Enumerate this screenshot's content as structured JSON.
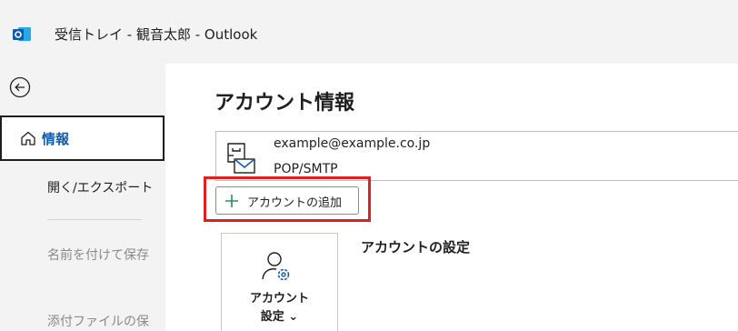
{
  "window": {
    "title": "受信トレイ - 観音太郎  -  Outlook"
  },
  "sidebar": {
    "back_icon": "back-arrow-icon",
    "items": [
      {
        "label": "情報",
        "icon": "home-icon",
        "selected": true
      },
      {
        "label": "開く/エクスポート"
      },
      {
        "label": "名前を付けて保存",
        "disabled": true
      },
      {
        "label": "添付ファイルの保",
        "disabled": true
      }
    ]
  },
  "main": {
    "title": "アカウント情報",
    "account": {
      "email": "example@example.co.jp",
      "type": "POP/SMTP"
    },
    "add_account_label": "アカウントの追加",
    "settings_button": {
      "line1": "アカウント",
      "line2": "設定 ⌄"
    },
    "settings_heading": "アカウントの設定"
  },
  "colors": {
    "accent": "#0f5cad",
    "highlight": "#e01f1f",
    "plus": "#2e8b57"
  }
}
